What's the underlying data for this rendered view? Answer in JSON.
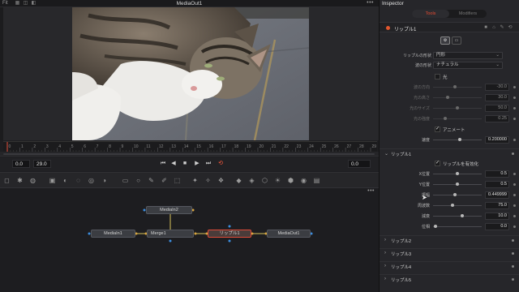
{
  "viewer": {
    "fit_label": "Fit",
    "title": "MediaOut1",
    "menu": "•••"
  },
  "timeline": {
    "ticks": [
      "0",
      "1",
      "2",
      "3",
      "4",
      "5",
      "6",
      "7",
      "8",
      "9",
      "10",
      "11",
      "12",
      "13",
      "14",
      "15",
      "16",
      "17",
      "18",
      "19",
      "20",
      "21",
      "22",
      "23",
      "24",
      "25",
      "26",
      "27",
      "28",
      "29"
    ],
    "start": "0.0",
    "end": "29.0",
    "current": "0.0"
  },
  "transport": {
    "first": "⏮",
    "back": "◀",
    "stop": "■",
    "play": "▶",
    "last": "⏭",
    "loop": "⟲"
  },
  "nodes": {
    "media_in": "MediaIn1",
    "merge": "Merge1",
    "ripple": "リップル1",
    "media_out": "MediaOut1",
    "media_in2": "MediaIn2",
    "menu": "•••"
  },
  "inspector": {
    "title": "Inspector",
    "tabs": [
      "Tools",
      "Modifiers"
    ],
    "tool_name": "リップル1",
    "shape_label": "リップルの形状",
    "shape_value": "円形",
    "wave_label": "波の形状",
    "wave_value": "ナチュラル",
    "light_label": "光",
    "params_dim": [
      {
        "label": "波の方向",
        "value": "-30.0"
      },
      {
        "label": "光の高さ",
        "value": "30.0"
      },
      {
        "label": "光のサイズ",
        "value": "50.0"
      },
      {
        "label": "光の強度",
        "value": "0.25"
      }
    ],
    "animate_label": "アニメート",
    "speed_label": "速度",
    "speed_value": "0.200000",
    "section1": "リップル1",
    "enable_label": "リップルを有効化",
    "params": [
      {
        "label": "X位置",
        "value": "0.5"
      },
      {
        "label": "Y位置",
        "value": "0.5"
      },
      {
        "label": "振幅",
        "value": "0.449999"
      },
      {
        "label": "周波数",
        "value": "75.0"
      },
      {
        "label": "減衰",
        "value": "10.0"
      },
      {
        "label": "位相",
        "value": "0.0"
      }
    ],
    "sections": [
      "リップル2",
      "リップル3",
      "リップル4",
      "リップル5"
    ]
  },
  "colors": {
    "accent": "#e44b32",
    "selected_node": "#e04c3a",
    "background": "#1e1e21"
  }
}
